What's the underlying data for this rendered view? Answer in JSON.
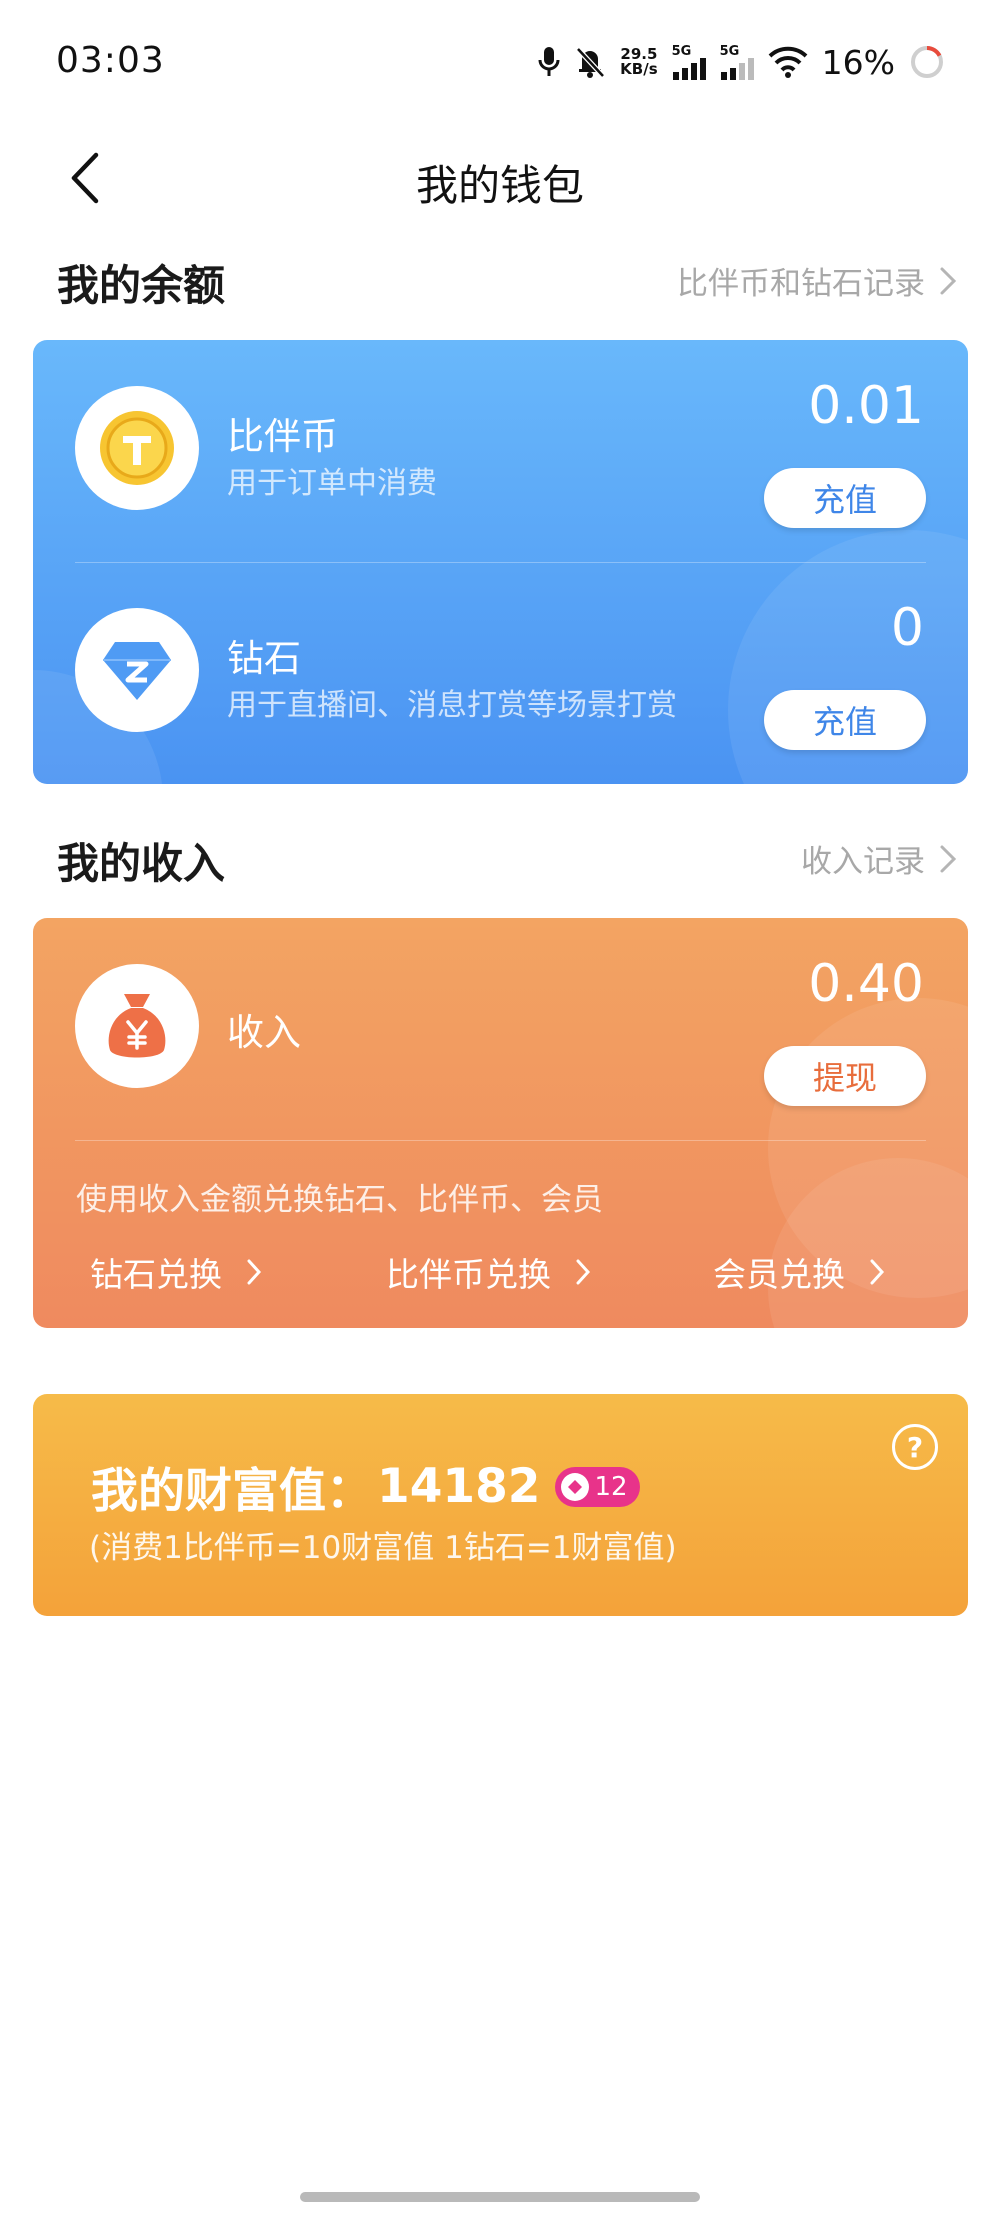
{
  "status_bar": {
    "time": "03:03",
    "net_speed_value": "29.5",
    "net_speed_unit": "KB/s",
    "signal_1": "5G",
    "signal_2": "5G",
    "battery": "16%"
  },
  "nav": {
    "title": "我的钱包"
  },
  "balance_section": {
    "title": "我的余额",
    "link_label": "比伴币和钻石记录"
  },
  "balance_card": {
    "coin": {
      "title": "比伴币",
      "subtitle": "用于订单中消费",
      "amount": "0.01",
      "button": "充值"
    },
    "diamond": {
      "title": "钻石",
      "subtitle": "用于直播间、消息打赏等场景打赏",
      "amount": "0",
      "button": "充值"
    }
  },
  "income_section": {
    "title": "我的收入",
    "link_label": "收入记录"
  },
  "income_card": {
    "title": "收入",
    "amount": "0.40",
    "button": "提现",
    "hint": "使用收入金额兑换钻石、比伴币、会员",
    "exchanges": [
      "钻石兑换",
      "比伴币兑换",
      "会员兑换"
    ]
  },
  "wealth_card": {
    "label": "我的财富值：",
    "value": "14182",
    "level": "12",
    "note": "(消费1比伴币=10财富值 1钻石=1财富值)",
    "help": "?"
  },
  "colors": {
    "balance_gradient_top": "#69b8fb",
    "balance_gradient_bottom": "#4a93f2",
    "income_gradient_top": "#f3a462",
    "income_gradient_bottom": "#ef8a5f",
    "wealth_gradient_top": "#f6bb49",
    "wealth_gradient_bottom": "#f4a23a",
    "level_badge": "#e8338a"
  },
  "icons": [
    "microphone-icon",
    "mute-bell-icon",
    "signal-icon",
    "wifi-icon",
    "battery-ring-icon",
    "back-arrow-icon",
    "chevron-right-icon",
    "coin-icon",
    "diamond-icon",
    "money-bag-icon",
    "help-icon"
  ]
}
